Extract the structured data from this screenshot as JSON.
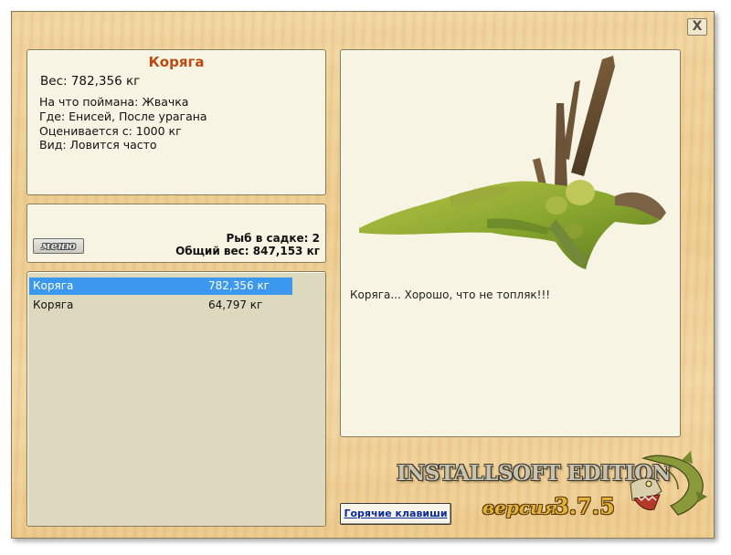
{
  "window": {
    "close_label": "X"
  },
  "catch_info": {
    "title": "Коряга",
    "weight": "Вес: 782,356 кг",
    "lines": [
      "На что поймана: Жвачка",
      "Где: Енисей, После урагана",
      "Оценивается с: 1000 кг",
      "Вид: Ловится часто"
    ]
  },
  "keepnet": {
    "menu_label": "меню",
    "fish_count": "Рыб в садке: 2",
    "total_weight": "Общий вес: 847,153 кг"
  },
  "catch_list": [
    {
      "name": "Коряга",
      "weight": "782,356 кг",
      "selected": true
    },
    {
      "name": "Коряга",
      "weight": "64,797 кг",
      "selected": false
    }
  ],
  "preview": {
    "image": "driftwood-snag-image",
    "description": "Коряга... Хорошо, что не топляк!!!"
  },
  "footer": {
    "hotkeys_label": "Горячие клавиши",
    "edition_text": "INSTALLSOFT EDITION",
    "version_label": "версия",
    "version_number": "3.7.5",
    "logo": "pike-fish-logo"
  },
  "colors": {
    "title": "#b94a12",
    "selection": "#3c98ee",
    "panel": "#f7f4e3",
    "list_bg": "#ddd9bf",
    "version_gold": "#e2b23a"
  }
}
